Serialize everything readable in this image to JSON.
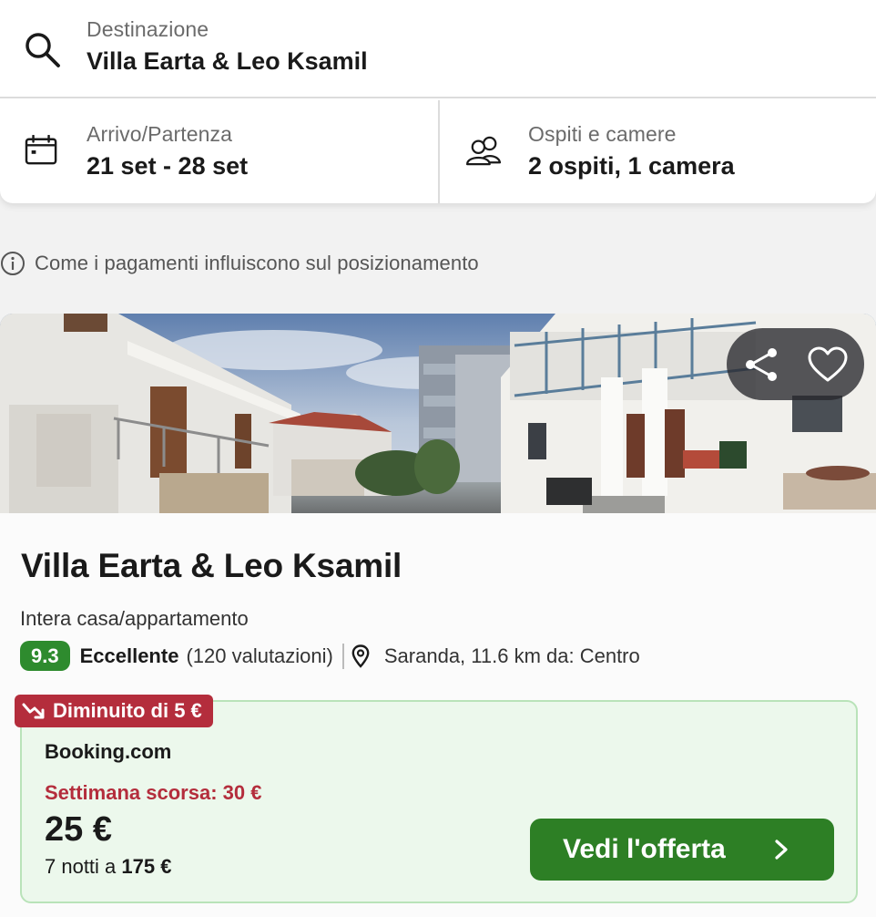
{
  "search": {
    "destination_label": "Destinazione",
    "destination_value": "Villa Earta & Leo Ksamil",
    "dates_label": "Arrivo/Partenza",
    "dates_value": "21 set - 28 set",
    "guests_label": "Ospiti e camere",
    "guests_value": "2 ospiti, 1 camera"
  },
  "info": {
    "text": "Come i pagamenti influiscono sul posizionamento"
  },
  "hotel": {
    "name": "Villa Earta & Leo Ksamil",
    "type": "Intera casa/appartamento",
    "score": "9.3",
    "rating_word": "Eccellente",
    "rating_count": "(120 valutazioni)",
    "location": "Saranda, 11.6 km da: Centro"
  },
  "offer": {
    "drop_badge": "Diminuito di 5 €",
    "provider": "Booking.com",
    "last_week": "Settimana scorsa: 30 €",
    "price": "25 €",
    "nights_prefix": "7 notti a",
    "nights_total": "175 €",
    "cta_label": "Vedi l'offerta"
  },
  "icons": {
    "search": "search-icon",
    "calendar": "calendar-icon",
    "guests": "people-icon",
    "info": "info-icon",
    "share": "share-icon",
    "favorite": "heart-icon",
    "location": "pin-icon",
    "trend": "trend-down-icon",
    "chevron": "chevron-right-icon"
  },
  "colors": {
    "score_badge": "#2e8b2e",
    "cta": "#2d7f25",
    "price_drop": "#b42d3c",
    "offer_bg": "#ecf8ec"
  }
}
